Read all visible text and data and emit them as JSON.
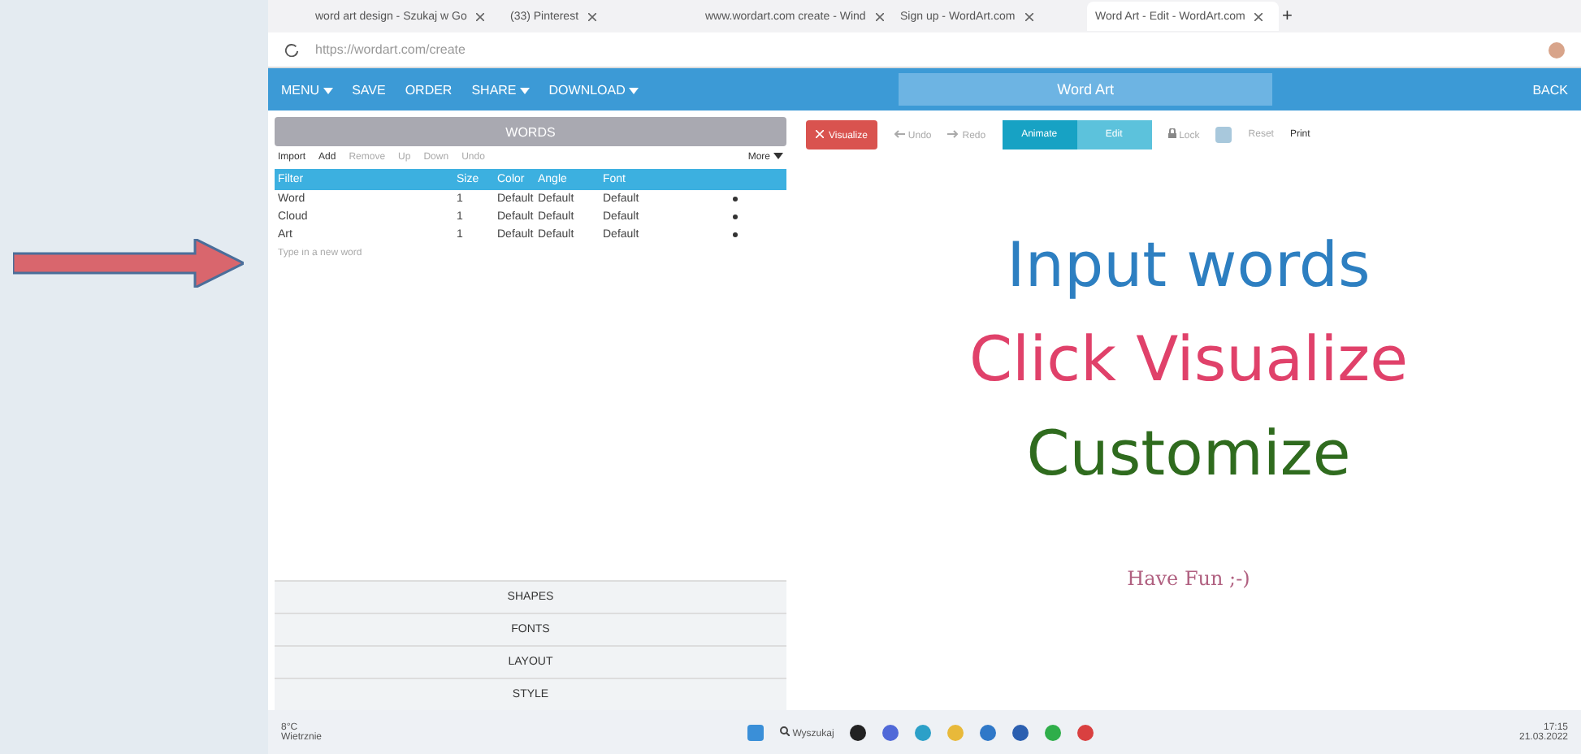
{
  "browser": {
    "tabs": [
      {
        "title": "word art design - Szukaj w Go",
        "selected": false
      },
      {
        "title": "(33) Pinterest",
        "selected": false
      },
      {
        "title": "www.wordart.com create - Wind",
        "selected": false
      },
      {
        "title": "Sign up - WordArt.com",
        "selected": false
      },
      {
        "title": "Word Art - Edit - WordArt.com",
        "selected": true
      }
    ],
    "new_tab": "+",
    "address": "https://wordart.com/create"
  },
  "app_bar": {
    "menu": [
      {
        "label": "MENU",
        "caret": true
      },
      {
        "label": "SAVE",
        "caret": false
      },
      {
        "label": "ORDER",
        "caret": false
      },
      {
        "label": "SHARE",
        "caret": true
      },
      {
        "label": "DOWNLOAD",
        "caret": true
      }
    ],
    "title": "Word Art",
    "back": "BACK"
  },
  "words_panel": {
    "title": "WORDS",
    "toolbar": [
      {
        "label": "Import",
        "disabled": false
      },
      {
        "label": "Add",
        "disabled": false
      },
      {
        "label": "Remove",
        "disabled": true
      },
      {
        "label": "Up",
        "disabled": true
      },
      {
        "label": "Down",
        "disabled": true
      },
      {
        "label": "Undo",
        "disabled": true
      }
    ],
    "more": "More",
    "columns": [
      "Filter",
      "Size",
      "Color",
      "Angle",
      "Font"
    ],
    "rows": [
      [
        "Word",
        "1",
        "Default",
        "Default",
        "Default"
      ],
      [
        "Cloud",
        "1",
        "Default",
        "Default",
        "Default"
      ],
      [
        "Art",
        "1",
        "Default",
        "Default",
        "Default"
      ]
    ],
    "placeholder": "Type in a new word",
    "sections": [
      "SHAPES",
      "FONTS",
      "LAYOUT",
      "STYLE"
    ]
  },
  "canvas_toolbar": {
    "visualize": "Visualize",
    "undo": "Undo",
    "redo": "Redo",
    "modes": [
      {
        "label": "Animate",
        "selected": true
      },
      {
        "label": "Edit",
        "selected": false
      }
    ],
    "lock": "Lock",
    "reset": "Reset",
    "print": "Print"
  },
  "canvas": {
    "lines": [
      {
        "text": "Input words",
        "color": "#2d7fc1"
      },
      {
        "text": "Click Visualize",
        "color": "#e0416a"
      },
      {
        "text": "Customize",
        "color": "#2f6b1e"
      }
    ],
    "note": "Have Fun ;-)"
  },
  "taskbar": {
    "temperature": "8°C",
    "weather": "Wietrznie",
    "search": "Wyszukaj",
    "time": "17:15",
    "date": "21.03.2022"
  }
}
